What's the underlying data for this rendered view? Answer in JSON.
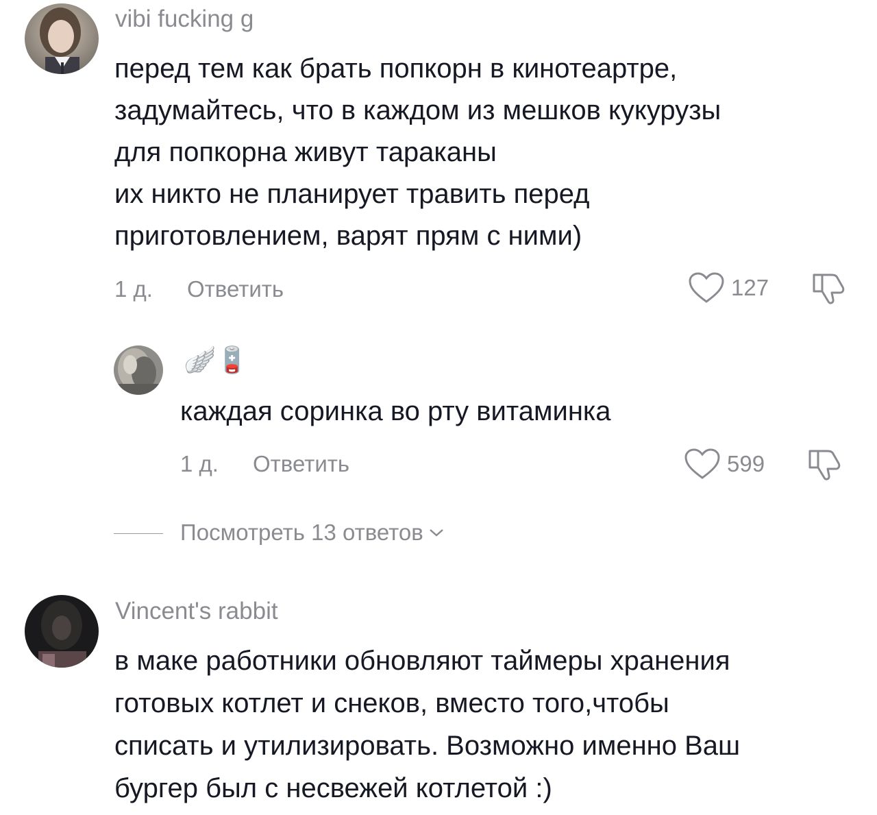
{
  "comments": [
    {
      "username": "vibi fucking g",
      "avatar_icon": "user-avatar-photo",
      "lines": [
        "перед тем как брать попкорн в кинотеартре,",
        "задумайтесь, что в каждом из мешков кукурузы",
        "для попкорна живут тараканы",
        "их никто не планирует травить перед",
        "приготовлением, варят прям с ними)"
      ],
      "age": "1 д.",
      "reply_label": "Ответить",
      "likes": "127"
    },
    {
      "username": "🪽🪫",
      "avatar_icon": "user-avatar-photo",
      "lines": [
        "каждая соринка во рту витаминка"
      ],
      "age": "1 д.",
      "reply_label": "Ответить",
      "likes": "599"
    },
    {
      "username": "Vincent's rabbit",
      "avatar_icon": "user-avatar-photo",
      "lines": [
        "в маке работники обновляют таймеры хранения",
        "готовых котлет и снеков, вместо того,чтобы",
        "списать и утилизировать. Возможно именно Ваш",
        "бургер был с несвежей котлетой :)"
      ]
    }
  ],
  "view_replies": {
    "label": "Посмотреть 13 ответов"
  },
  "colors": {
    "text": "#161823",
    "secondary": "#8a8b91"
  }
}
